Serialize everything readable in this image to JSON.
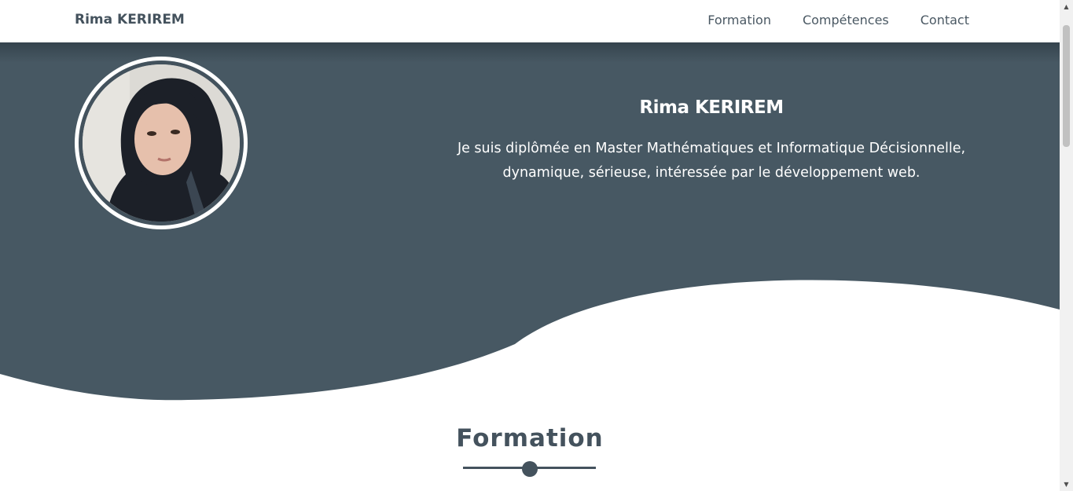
{
  "nav": {
    "brand": "Rima KERIREM",
    "links": [
      "Formation",
      "Compétences",
      "Contact"
    ]
  },
  "hero": {
    "name": "Rima KERIREM",
    "bio_line1": "Je suis diplômée en Master Mathématiques et Informatique Décisionnelle,",
    "bio_line2": "dynamique, sérieuse, intéressée par le développement web."
  },
  "section": {
    "title": "Formation"
  },
  "colors": {
    "hero_bg": "#475863",
    "text_dark": "#44525d",
    "white": "#ffffff"
  },
  "scrollbar": {
    "up_icon": "▲",
    "down_icon": "▼"
  }
}
